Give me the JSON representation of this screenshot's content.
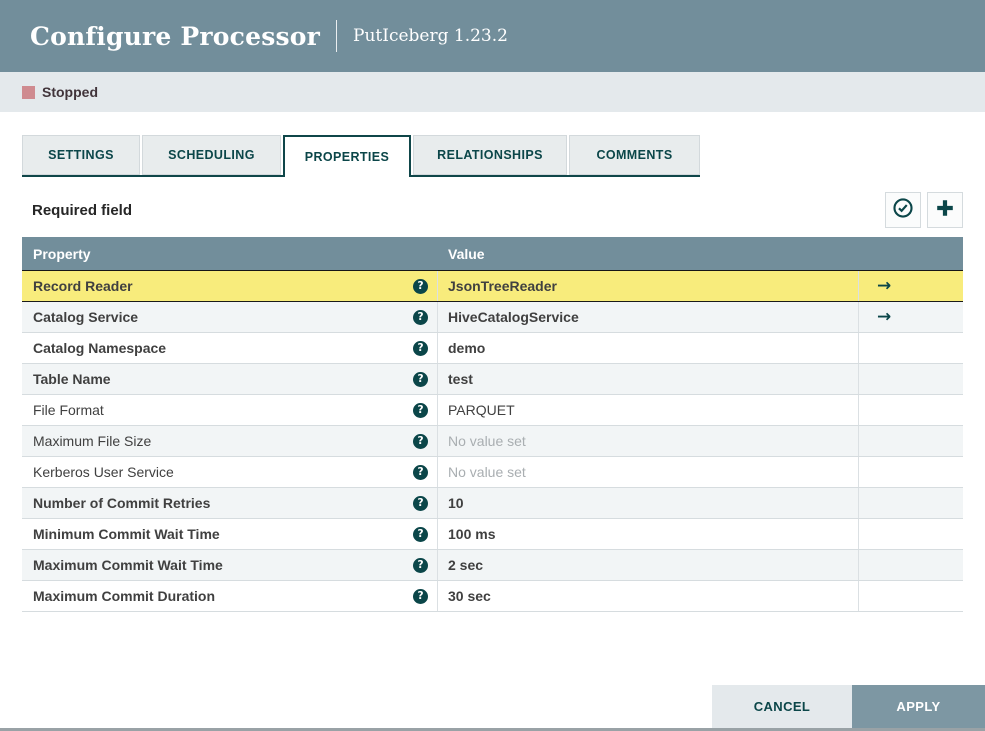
{
  "dialog": {
    "title": "Configure Processor",
    "subtitle": "PutIceberg 1.23.2",
    "status": {
      "label": "Stopped"
    },
    "tabs": [
      {
        "label": "SETTINGS",
        "active": false
      },
      {
        "label": "SCHEDULING",
        "active": false
      },
      {
        "label": "PROPERTIES",
        "active": true
      },
      {
        "label": "RELATIONSHIPS",
        "active": false
      },
      {
        "label": "COMMENTS",
        "active": false
      }
    ],
    "toolbar": {
      "required_label": "Required field",
      "verify_icon": "circle-check-icon",
      "add_icon": "plus-icon"
    },
    "table": {
      "columns": {
        "property": "Property",
        "value": "Value"
      },
      "help_glyph": "?",
      "link_glyph": "→",
      "rows": [
        {
          "property": "Record Reader",
          "value": "JsonTreeReader",
          "required": true,
          "value_set": true,
          "has_link": true,
          "selected": true
        },
        {
          "property": "Catalog Service",
          "value": "HiveCatalogService",
          "required": true,
          "value_set": true,
          "has_link": true,
          "selected": false
        },
        {
          "property": "Catalog Namespace",
          "value": "demo",
          "required": true,
          "value_set": true,
          "has_link": false,
          "selected": false
        },
        {
          "property": "Table Name",
          "value": "test",
          "required": true,
          "value_set": true,
          "has_link": false,
          "selected": false
        },
        {
          "property": "File Format",
          "value": "PARQUET",
          "required": false,
          "value_set": true,
          "has_link": false,
          "selected": false
        },
        {
          "property": "Maximum File Size",
          "value": "No value set",
          "required": false,
          "value_set": false,
          "has_link": false,
          "selected": false
        },
        {
          "property": "Kerberos User Service",
          "value": "No value set",
          "required": false,
          "value_set": false,
          "has_link": false,
          "selected": false
        },
        {
          "property": "Number of Commit Retries",
          "value": "10",
          "required": true,
          "value_set": true,
          "has_link": false,
          "selected": false
        },
        {
          "property": "Minimum Commit Wait Time",
          "value": "100 ms",
          "required": true,
          "value_set": true,
          "has_link": false,
          "selected": false
        },
        {
          "property": "Maximum Commit Wait Time",
          "value": "2 sec",
          "required": true,
          "value_set": true,
          "has_link": false,
          "selected": false
        },
        {
          "property": "Maximum Commit Duration",
          "value": "30 sec",
          "required": true,
          "value_set": true,
          "has_link": false,
          "selected": false
        }
      ]
    },
    "footer": {
      "cancel_label": "CANCEL",
      "apply_label": "APPLY"
    },
    "colors": {
      "header_bg": "#728e9b",
      "accent_teal": "#0b4649",
      "selected_row": "#f8ec7c",
      "status_stopped": "#cf8b90",
      "status_bar_bg": "#e4e9ec",
      "apply_button_bg": "#7d97a3"
    }
  }
}
